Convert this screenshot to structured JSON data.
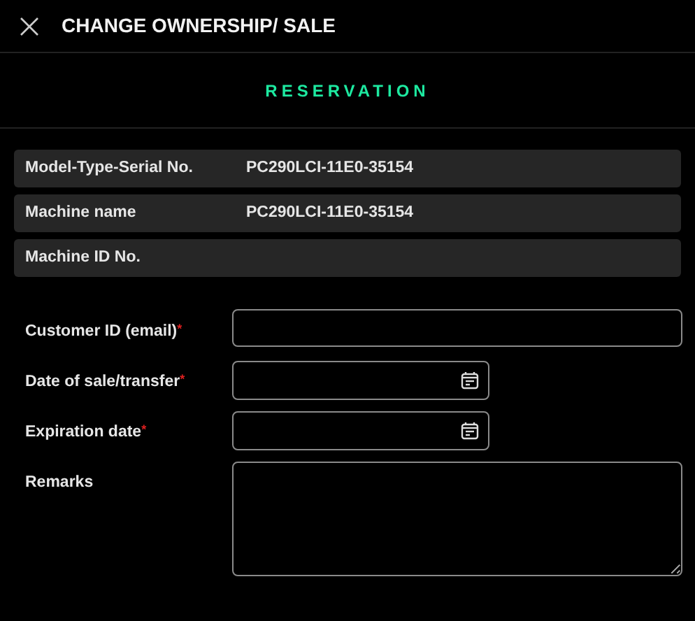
{
  "header": {
    "title": "CHANGE OWNERSHIP/ SALE"
  },
  "section": {
    "title": "RESERVATION"
  },
  "info_rows": [
    {
      "label": "Model-Type-Serial No.",
      "value": "PC290LCI-11E0-35154"
    },
    {
      "label": "Machine name",
      "value": "PC290LCI-11E0-35154"
    },
    {
      "label": "Machine ID No."
    }
  ],
  "form_fields": [
    {
      "label": "Customer ID (email)",
      "kind": "text",
      "required_mark": "*"
    },
    {
      "label": "Date of sale/transfer",
      "kind": "date",
      "required_mark": "*"
    },
    {
      "label": "Expiration date",
      "kind": "date",
      "required_mark": "*"
    },
    {
      "label": "Remarks",
      "kind": "textarea"
    }
  ]
}
